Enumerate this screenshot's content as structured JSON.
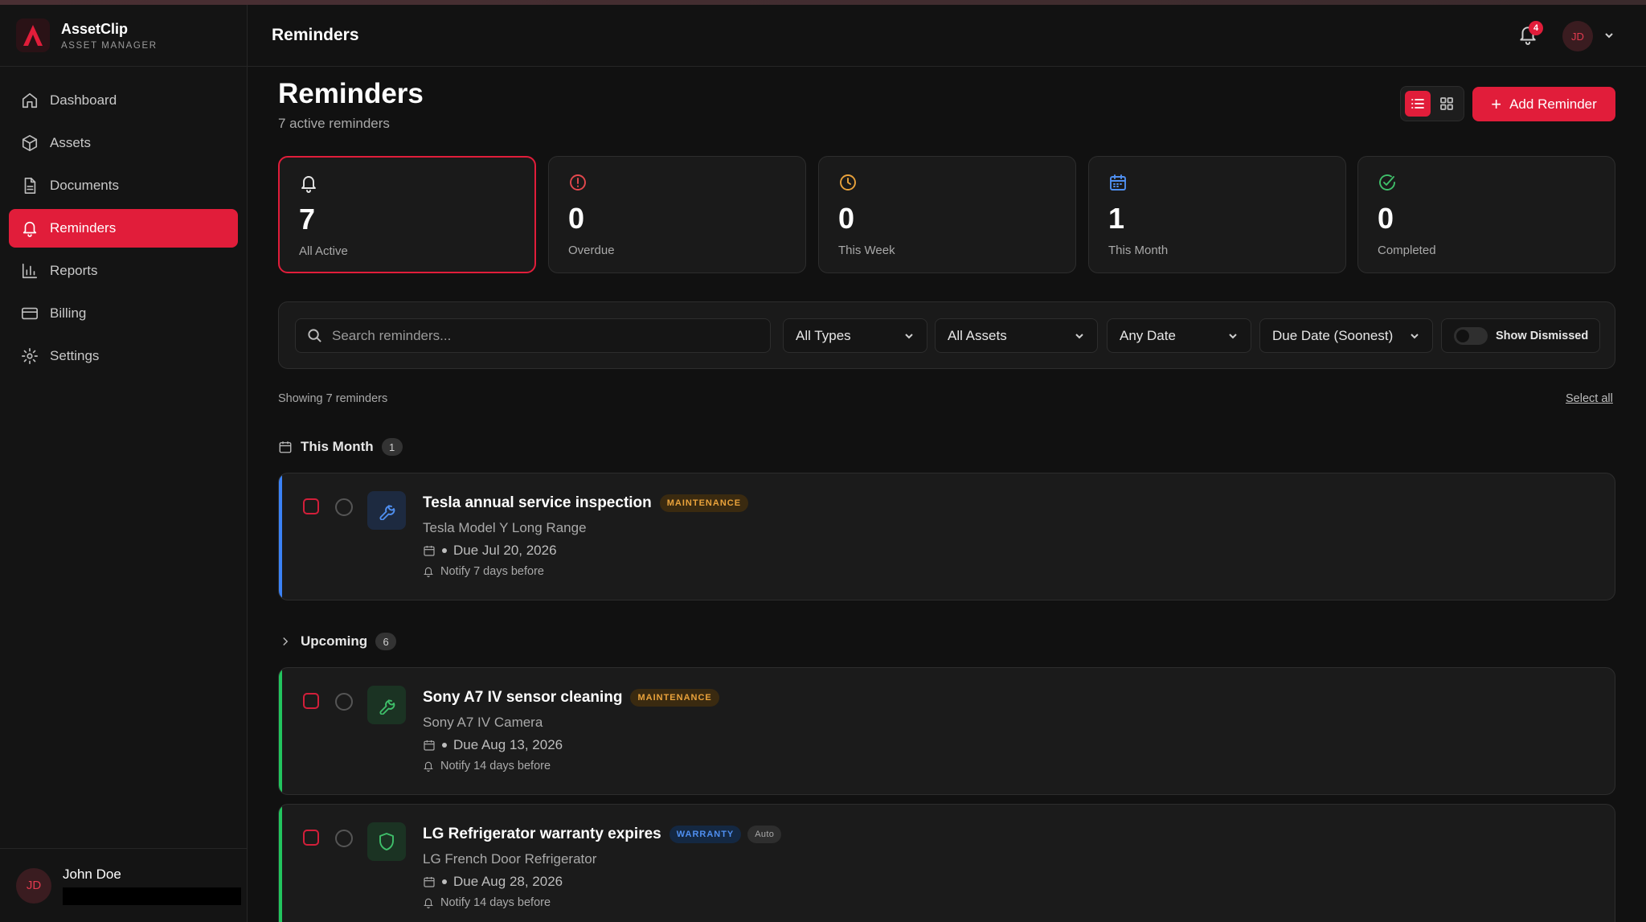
{
  "brand": {
    "name": "AssetClip",
    "subtitle": "ASSET MANAGER",
    "logo_icon": "assetclip-logo"
  },
  "sidebar": {
    "items": [
      {
        "label": "Dashboard",
        "icon": "home-icon",
        "active": false
      },
      {
        "label": "Assets",
        "icon": "box-icon",
        "active": false
      },
      {
        "label": "Documents",
        "icon": "document-icon",
        "active": false
      },
      {
        "label": "Reminders",
        "icon": "bell-icon",
        "active": true
      },
      {
        "label": "Reports",
        "icon": "bar-chart-icon",
        "active": false
      },
      {
        "label": "Billing",
        "icon": "credit-card-icon",
        "active": false
      },
      {
        "label": "Settings",
        "icon": "gear-icon",
        "active": false
      }
    ],
    "user": {
      "initials": "JD",
      "name": "John Doe"
    }
  },
  "header": {
    "title": "Reminders",
    "notification_count": "4",
    "avatar_initials": "JD"
  },
  "page": {
    "title": "Reminders",
    "subtitle": "7 active reminders",
    "add_button_label": "Add Reminder",
    "view_mode": "list"
  },
  "stats": [
    {
      "value": "7",
      "label": "All Active",
      "icon": "bell-icon",
      "color": "#e6e6e6",
      "active": true
    },
    {
      "value": "0",
      "label": "Overdue",
      "icon": "alert-circle-icon",
      "color": "#e5484d",
      "active": false
    },
    {
      "value": "0",
      "label": "This Week",
      "icon": "clock-icon",
      "color": "#e9a23b",
      "active": false
    },
    {
      "value": "1",
      "label": "This Month",
      "icon": "calendar-icon",
      "color": "#4f8ff0",
      "active": false
    },
    {
      "value": "0",
      "label": "Completed",
      "icon": "check-circle-icon",
      "color": "#3fbf6a",
      "active": false
    }
  ],
  "filters": {
    "search_placeholder": "Search reminders...",
    "type": "All Types",
    "asset": "All Assets",
    "date": "Any Date",
    "sort": "Due Date (Soonest)",
    "show_dismissed_label": "Show Dismissed",
    "show_dismissed": false
  },
  "list": {
    "showing_text": "Showing 7 reminders",
    "select_all_label": "Select all"
  },
  "groups": [
    {
      "title": "This Month",
      "count": "1",
      "icon": "calendar-icon",
      "expanded": true,
      "items": [
        {
          "title": "Tesla annual service inspection",
          "tag": "MAINTENANCE",
          "asset": "Tesla Model Y Long Range",
          "due": "Due Jul 20, 2026",
          "notify": "Notify 7 days before",
          "accent": "#3b82f6",
          "icon": "wrench-icon",
          "icon_color": "#4f8ff0",
          "icon_bg": "#1d2a40"
        }
      ]
    },
    {
      "title": "Upcoming",
      "count": "6",
      "icon": "chevron-right-icon",
      "expanded": true,
      "items": [
        {
          "title": "Sony A7 IV sensor cleaning",
          "tag": "MAINTENANCE",
          "asset": "Sony A7 IV Camera",
          "due": "Due Aug 13, 2026",
          "notify": "Notify 14 days before",
          "accent": "#22c55e",
          "icon": "wrench-icon",
          "icon_color": "#3fbf6a",
          "icon_bg": "#1b3323"
        },
        {
          "title": "LG Refrigerator warranty expires",
          "tag": "WARRANTY",
          "tag2": "Auto",
          "asset": "LG French Door Refrigerator",
          "due": "Due Aug 28, 2026",
          "notify": "Notify 14 days before",
          "accent": "#22c55e",
          "icon": "shield-icon",
          "icon_color": "#3fbf6a",
          "icon_bg": "#1b3323"
        }
      ]
    }
  ]
}
